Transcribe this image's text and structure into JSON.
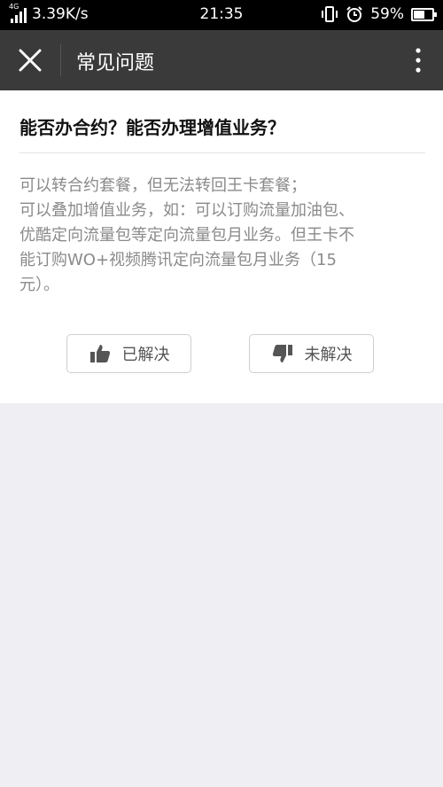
{
  "status_bar": {
    "network_type": "4G",
    "speed": "3.39K/s",
    "time": "21:35",
    "battery_percent": "59%",
    "battery_level": 0.59
  },
  "app_bar": {
    "title": "常见问题"
  },
  "faq": {
    "question": "能否办合约？能否办理增值业务？",
    "answer_lines": [
      "可以转合约套餐，但无法转回王卡套餐；",
      "可以叠加增值业务，如：可以订购流量加油包、",
      "优酷定向流量包等定向流量包月业务。但王卡不",
      "能订购WO+视频腾讯定向流量包月业务（15",
      "元）。"
    ]
  },
  "feedback": {
    "solved_label": "已解决",
    "unsolved_label": "未解决"
  }
}
